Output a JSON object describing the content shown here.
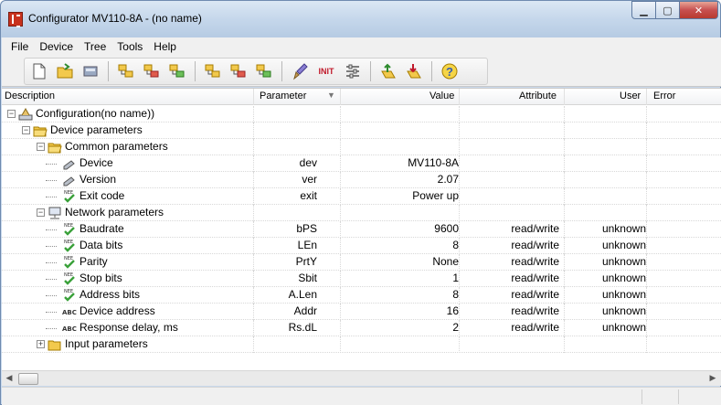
{
  "window": {
    "title": "Configurator MV110-8A - (no name)"
  },
  "menu": [
    "File",
    "Device",
    "Tree",
    "Tools",
    "Help"
  ],
  "toolbar": {
    "init_label": "INIT"
  },
  "columns": {
    "description": "Description",
    "parameter": "Parameter",
    "value": "Value",
    "attribute": "Attribute",
    "user": "User",
    "error": "Error"
  },
  "tree": [
    {
      "label": "Configuration(no name))",
      "icon": "configuration-icon",
      "level": 0,
      "expander": "−"
    },
    {
      "label": "Device parameters",
      "icon": "folder-open-icon",
      "level": 1,
      "expander": "−"
    },
    {
      "label": "Common parameters",
      "icon": "folder-open-icon",
      "level": 2,
      "expander": "−"
    },
    {
      "label": "Device",
      "icon": "pencil-icon",
      "level": 3,
      "parameter": "dev",
      "value": "MV110-8A"
    },
    {
      "label": "Version",
      "icon": "pencil-icon",
      "level": 3,
      "parameter": "ver",
      "value": "2.07"
    },
    {
      "label": "Exit code",
      "icon": "check-nee-icon",
      "level": 3,
      "parameter": "exit",
      "value": "Power up"
    },
    {
      "label": "Network parameters",
      "icon": "network-icon",
      "level": 2,
      "expander": "−"
    },
    {
      "label": "Baudrate",
      "icon": "check-nee-icon",
      "level": 3,
      "parameter": "bPS",
      "value": "9600",
      "attribute": "read/write",
      "user": "unknown"
    },
    {
      "label": "Data bits",
      "icon": "check-nee-icon",
      "level": 3,
      "parameter": "LEn",
      "value": "8",
      "attribute": "read/write",
      "user": "unknown"
    },
    {
      "label": "Parity",
      "icon": "check-nee-icon",
      "level": 3,
      "parameter": "PrtY",
      "value": "None",
      "attribute": "read/write",
      "user": "unknown"
    },
    {
      "label": "Stop bits",
      "icon": "check-nee-icon",
      "level": 3,
      "parameter": "Sbit",
      "value": "1",
      "attribute": "read/write",
      "user": "unknown"
    },
    {
      "label": "Address bits",
      "icon": "check-nee-icon",
      "level": 3,
      "parameter": "A.Len",
      "value": "8",
      "attribute": "read/write",
      "user": "unknown"
    },
    {
      "label": "Device address",
      "icon": "abc-icon",
      "level": 3,
      "parameter": "Addr",
      "value": "16",
      "attribute": "read/write",
      "user": "unknown"
    },
    {
      "label": "Response delay, ms",
      "icon": "abc-icon",
      "level": 3,
      "parameter": "Rs.dL",
      "value": "2",
      "attribute": "read/write",
      "user": "unknown"
    },
    {
      "label": "Input parameters",
      "icon": "folder-closed-icon",
      "level": 2,
      "expander": "+"
    }
  ],
  "abc_text": "ABC",
  "nee_text": "NEE"
}
